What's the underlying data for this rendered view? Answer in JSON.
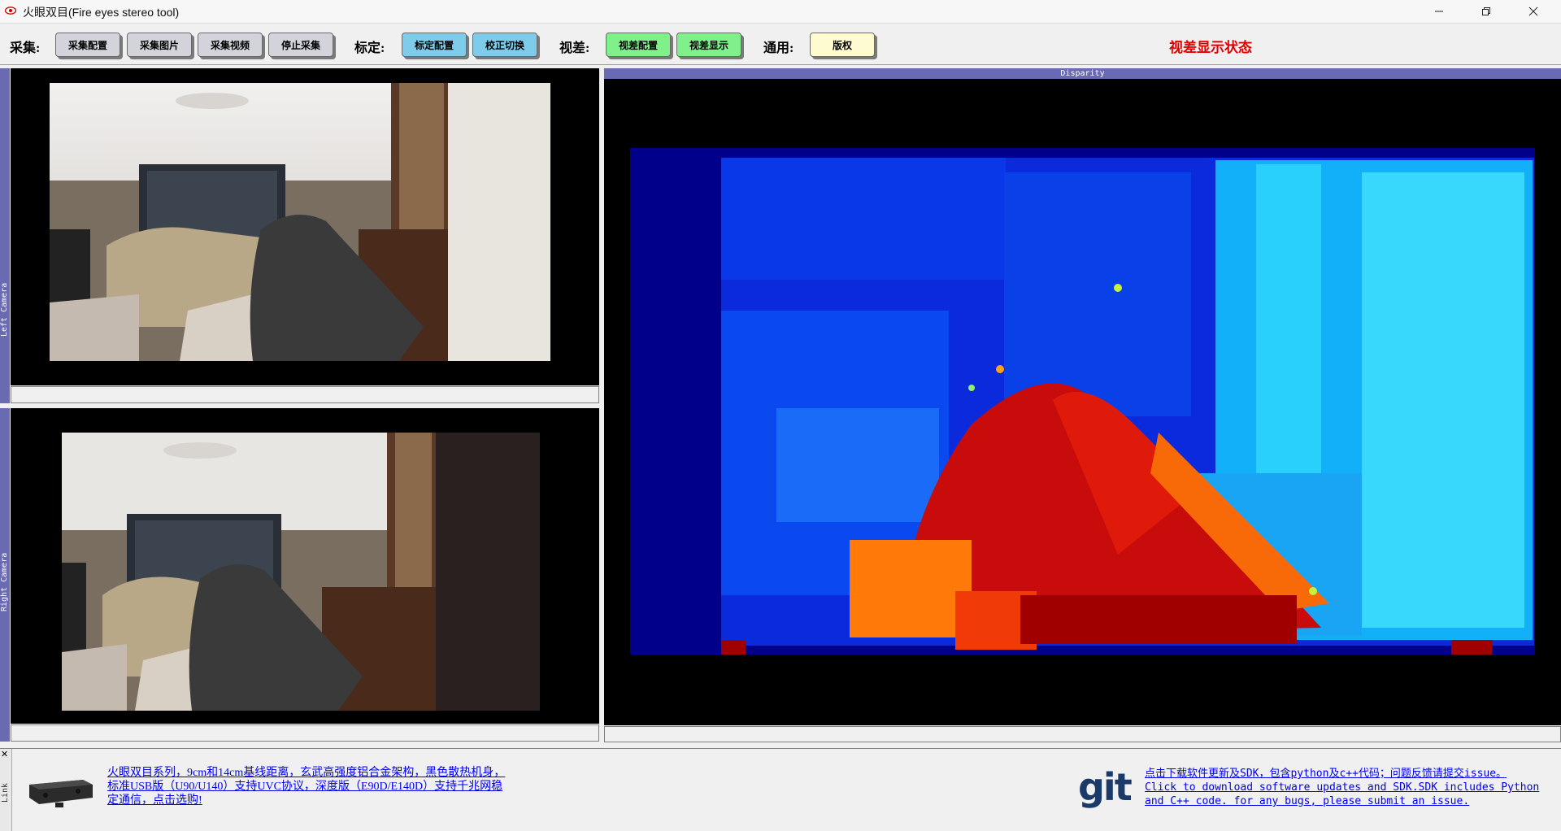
{
  "window": {
    "title": "火眼双目(Fire eyes stereo tool)",
    "controls": {
      "minimize": "—",
      "restore": "❐",
      "close": "✕"
    }
  },
  "toolbar": {
    "capture_label": "采集:",
    "capture_config": "采集配置",
    "capture_image": "采集图片",
    "capture_video": "采集视频",
    "stop_capture": "停止采集",
    "calib_label": "标定:",
    "calib_config": "标定配置",
    "rectify_toggle": "校正切换",
    "disparity_label": "视差:",
    "disparity_config": "视差配置",
    "disparity_show": "视差显示",
    "general_label": "通用:",
    "copyright": "版权",
    "status_text": "视差显示状态"
  },
  "panes": {
    "left_camera": "Left Camera",
    "right_camera": "Right Camera",
    "disparity": "Disparity"
  },
  "bottom": {
    "link_tab": "Link",
    "close_mark": "✕",
    "product_text": "火眼双目系列，9cm和14cm基线距离，玄武高强度铝合金架构，黑色散热机身，标准USB版（U90/U140）支持UVC协议，深度版（E90D/E140D）支持千兆网稳定通信，点击选购!",
    "git_logo": "git",
    "download_cn": "点击下载软件更新及SDK，包含python及c++代码；问题反馈请提交issue。",
    "download_en": "Click to download software updates and SDK.SDK includes Python and C++ code. for any bugs, please submit an issue."
  },
  "colors": {
    "accent_panel": "#6a6ab4",
    "btn_gray": "#d3d3dc",
    "btn_blue": "#7fcbea",
    "btn_green": "#7ff08a",
    "btn_yellow": "#fffbd0",
    "status_red": "#e00000",
    "link_blue": "#0000ee"
  }
}
